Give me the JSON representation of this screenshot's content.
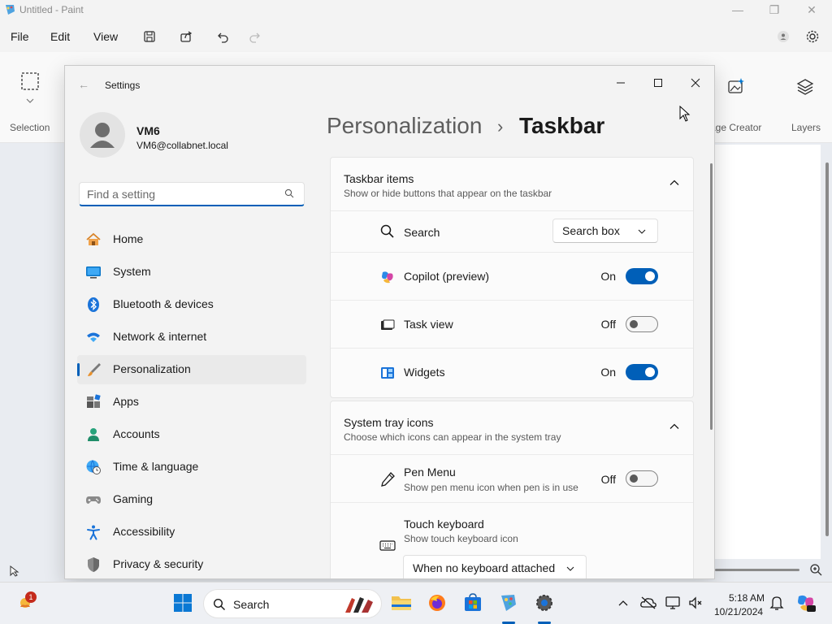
{
  "paint": {
    "title": "Untitled - Paint",
    "menu": [
      "File",
      "Edit",
      "View"
    ],
    "ribbon": {
      "selection_label": "Selection",
      "image_creator_label": "age Creator",
      "layers_label": "Layers"
    }
  },
  "settings": {
    "window_title": "Settings",
    "user": {
      "name": "VM6",
      "email": "VM6@collabnet.local"
    },
    "search_placeholder": "Find a setting",
    "nav": [
      {
        "label": "Home",
        "icon": "home-icon",
        "active": false
      },
      {
        "label": "System",
        "icon": "system-icon",
        "active": false
      },
      {
        "label": "Bluetooth & devices",
        "icon": "bluetooth-icon",
        "active": false
      },
      {
        "label": "Network & internet",
        "icon": "wifi-icon",
        "active": false
      },
      {
        "label": "Personalization",
        "icon": "brush-icon",
        "active": true
      },
      {
        "label": "Apps",
        "icon": "apps-icon",
        "active": false
      },
      {
        "label": "Accounts",
        "icon": "person-icon",
        "active": false
      },
      {
        "label": "Time & language",
        "icon": "globe-clock-icon",
        "active": false
      },
      {
        "label": "Gaming",
        "icon": "gamepad-icon",
        "active": false
      },
      {
        "label": "Accessibility",
        "icon": "accessibility-icon",
        "active": false
      },
      {
        "label": "Privacy & security",
        "icon": "shield-icon",
        "active": false
      }
    ],
    "breadcrumb": {
      "parent": "Personalization",
      "separator": "›",
      "current": "Taskbar"
    },
    "taskbar_items": {
      "title": "Taskbar items",
      "subtitle": "Show or hide buttons that appear on the taskbar",
      "search": {
        "label": "Search",
        "value": "Search box"
      },
      "copilot": {
        "label": "Copilot (preview)",
        "state": "On"
      },
      "task_view": {
        "label": "Task view",
        "state": "Off"
      },
      "widgets": {
        "label": "Widgets",
        "state": "On"
      }
    },
    "system_tray": {
      "title": "System tray icons",
      "subtitle": "Choose which icons can appear in the system tray",
      "pen_menu": {
        "label": "Pen Menu",
        "sub": "Show pen menu icon when pen is in use",
        "state": "Off"
      },
      "touch_keyboard": {
        "label": "Touch keyboard",
        "sub": "Show touch keyboard icon",
        "value": "When no keyboard attached"
      }
    }
  },
  "taskbar": {
    "search_label": "Search",
    "notification_badge": "1",
    "time": "5:18 AM",
    "date": "10/21/2024"
  },
  "colors": {
    "accent": "#005fb8",
    "toggle_off_knob": "#5a5a5a"
  }
}
